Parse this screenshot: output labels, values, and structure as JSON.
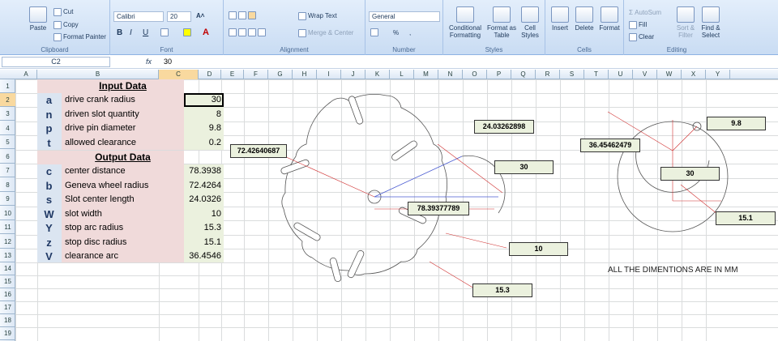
{
  "ribbon": {
    "clipboard": {
      "paste": "Paste",
      "cut": "Cut",
      "copy": "Copy",
      "format_painter": "Format Painter",
      "label": "Clipboard"
    },
    "font": {
      "name": "Calibri",
      "size": "20",
      "bold": "B",
      "italic": "I",
      "underline": "U",
      "label": "Font"
    },
    "alignment": {
      "wrap": "Wrap Text",
      "merge": "Merge & Center",
      "label": "Alignment"
    },
    "number": {
      "format": "General",
      "percent": "%",
      "comma": ",",
      "label": "Number"
    },
    "styles": {
      "conditional": "Conditional Formatting",
      "table": "Format as Table",
      "cell": "Cell Styles",
      "label": "Styles"
    },
    "cells": {
      "insert": "Insert",
      "delete": "Delete",
      "format": "Format",
      "label": "Cells"
    },
    "editing": {
      "autosum": "AutoSum",
      "fill": "Fill",
      "clear": "Clear",
      "sort": "Sort & Filter",
      "find": "Find & Select",
      "label": "Editing"
    }
  },
  "formula_bar": {
    "name_box": "C2",
    "fx": "fx",
    "value": "30"
  },
  "columns": [
    "A",
    "B",
    "C",
    "D",
    "E",
    "F",
    "G",
    "H",
    "I",
    "J",
    "K",
    "L",
    "M",
    "N",
    "O",
    "P",
    "Q",
    "R",
    "S",
    "T",
    "U",
    "V",
    "W",
    "X",
    "Y"
  ],
  "rows": [
    "1",
    "2",
    "3",
    "4",
    "5",
    "6",
    "7",
    "8",
    "9",
    "10",
    "11",
    "12",
    "13",
    "14",
    "15",
    "16",
    "17",
    "18",
    "19"
  ],
  "sheet": {
    "input_title": "Input Data",
    "output_title": "Output Data",
    "inputs": [
      {
        "sym": "a",
        "label": "drive crank radius",
        "value": "30"
      },
      {
        "sym": "n",
        "label": "driven slot quantity",
        "value": "8"
      },
      {
        "sym": "p",
        "label": "drive pin diameter",
        "value": "9.8"
      },
      {
        "sym": "t",
        "label": "allowed clearance",
        "value": "0.2"
      }
    ],
    "outputs": [
      {
        "sym": "c",
        "label": "center distance",
        "value": "78.3938"
      },
      {
        "sym": "b",
        "label": "Geneva wheel radius",
        "value": "72.4264"
      },
      {
        "sym": "s",
        "label": "Slot center length",
        "value": "24.0326"
      },
      {
        "sym": "W",
        "label": "slot width",
        "value": "10"
      },
      {
        "sym": "Y",
        "label": "stop arc radius",
        "value": "15.3"
      },
      {
        "sym": "z",
        "label": "stop disc radius",
        "value": "15.1"
      },
      {
        "sym": "V",
        "label": "clearance arc",
        "value": "36.4546"
      }
    ]
  },
  "drawing": {
    "dims": {
      "wheel_radius": "72.42640687",
      "slot_length": "24.03262898",
      "crank": "30",
      "center_distance": "78.39377789",
      "slot_width": "10",
      "stop_arc": "15.3",
      "pin": "9.8",
      "clearance_arc": "36.45462479",
      "crank_disc": "30",
      "stop_disc": "15.1"
    },
    "note": "ALL THE DIMENTIONS ARE IN MM"
  },
  "colors": {
    "accent": "#f9d99f",
    "pink": "#f0dada",
    "green": "#ebf1de",
    "blue": "#dbe5f1"
  }
}
